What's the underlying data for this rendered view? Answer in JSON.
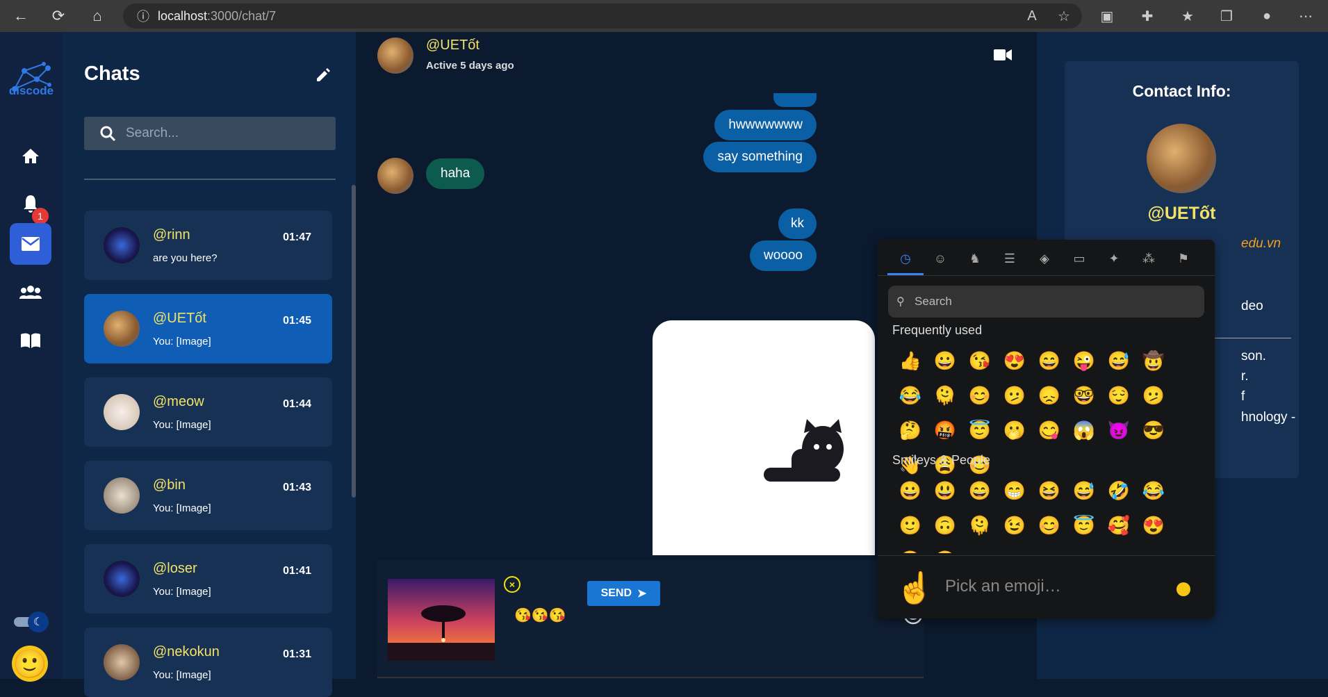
{
  "browser": {
    "url_host": "localhost",
    "url_path": ":3000/chat/7"
  },
  "app": {
    "logo_text": "discode",
    "notification_count": "1"
  },
  "sidebar": {
    "title": "Chats",
    "search_placeholder": "Search...",
    "chats": [
      {
        "name": "@rinn",
        "time": "01:47",
        "message": "are you here?",
        "active": false
      },
      {
        "name": "@UETốt",
        "time": "01:45",
        "message": "You: [Image]",
        "active": true
      },
      {
        "name": "@meow",
        "time": "01:44",
        "message": "You: [Image]",
        "active": false
      },
      {
        "name": "@bin",
        "time": "01:43",
        "message": "You: [Image]",
        "active": false
      },
      {
        "name": "@loser",
        "time": "01:41",
        "message": "You: [Image]",
        "active": false
      },
      {
        "name": "@nekokun",
        "time": "01:31",
        "message": "You: [Image]",
        "active": false
      }
    ]
  },
  "conversation": {
    "contact_name": "@UETốt",
    "status": "Active 5 days ago",
    "messages": [
      {
        "text": "hwwwwwww",
        "from": "me"
      },
      {
        "text": "say something",
        "from": "me"
      },
      {
        "text": "haha",
        "from": "them"
      },
      {
        "text": "kk",
        "from": "me"
      },
      {
        "text": "woooo",
        "from": "me"
      }
    ],
    "composer_text": "😘😘😘",
    "send_label": "SEND"
  },
  "contact_info": {
    "title": "Contact Info:",
    "name": "@UETốt",
    "email": "edu.vn",
    "video_label": "deo",
    "bio_line1": "son.",
    "bio_line2": "r.",
    "bio_line3": "f",
    "bio_line4": "hnology -"
  },
  "emoji_picker": {
    "search_placeholder": "Search",
    "section_frequent": "Frequently used",
    "section_smileys": "Smileys & People",
    "footer_placeholder": "Pick an emoji…",
    "preview_emoji": "☝️",
    "frequent": [
      "👍",
      "😀",
      "😘",
      "😍",
      "😄",
      "😜",
      "😅",
      "🤠",
      "😂",
      "🫠",
      "😊",
      "🫤",
      "😞",
      "🤓",
      "😌",
      "🫤",
      "🤔",
      "🤬",
      "😇",
      "🫢",
      "😋",
      "😱",
      "😈",
      "😎",
      "👋",
      "😩",
      "😊"
    ],
    "smileys": [
      "😀",
      "😃",
      "😄",
      "😁",
      "😆",
      "😅",
      "🤣",
      "😂",
      "🙂",
      "🙃",
      "🫠",
      "😉",
      "😊",
      "😇",
      "🥰",
      "😍",
      "🤩",
      "😘"
    ]
  }
}
